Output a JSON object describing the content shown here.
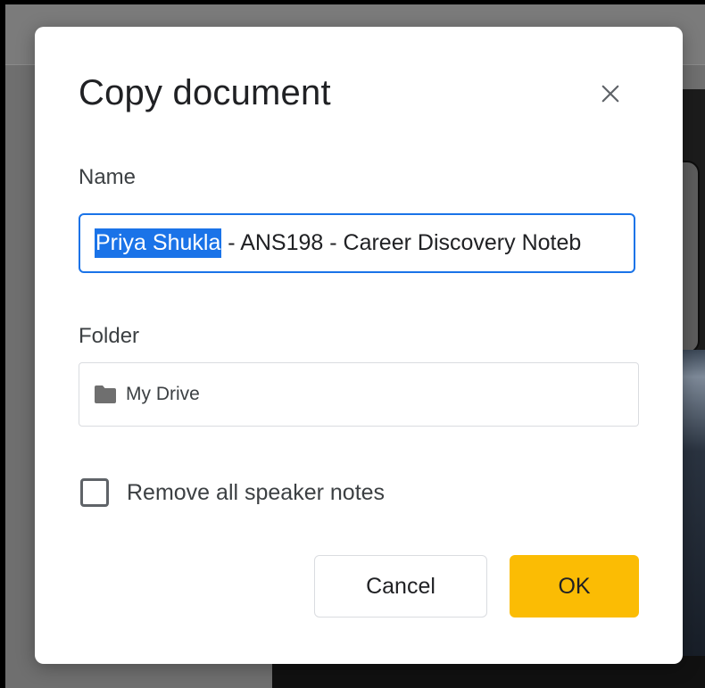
{
  "dialog": {
    "title": "Copy document",
    "close_icon": "close-icon",
    "name_label": "Name",
    "name_value_selected": "Priya Shukla",
    "name_value_rest": " - ANS198 - Career Discovery Noteb",
    "folder_label": "Folder",
    "folder_icon": "folder-icon",
    "folder_value": "My Drive",
    "checkbox_label": "Remove all speaker notes",
    "checkbox_checked": false,
    "cancel_label": "Cancel",
    "ok_label": "OK"
  },
  "colors": {
    "accent": "#1a73e8",
    "ok_button": "#fbbc04"
  }
}
